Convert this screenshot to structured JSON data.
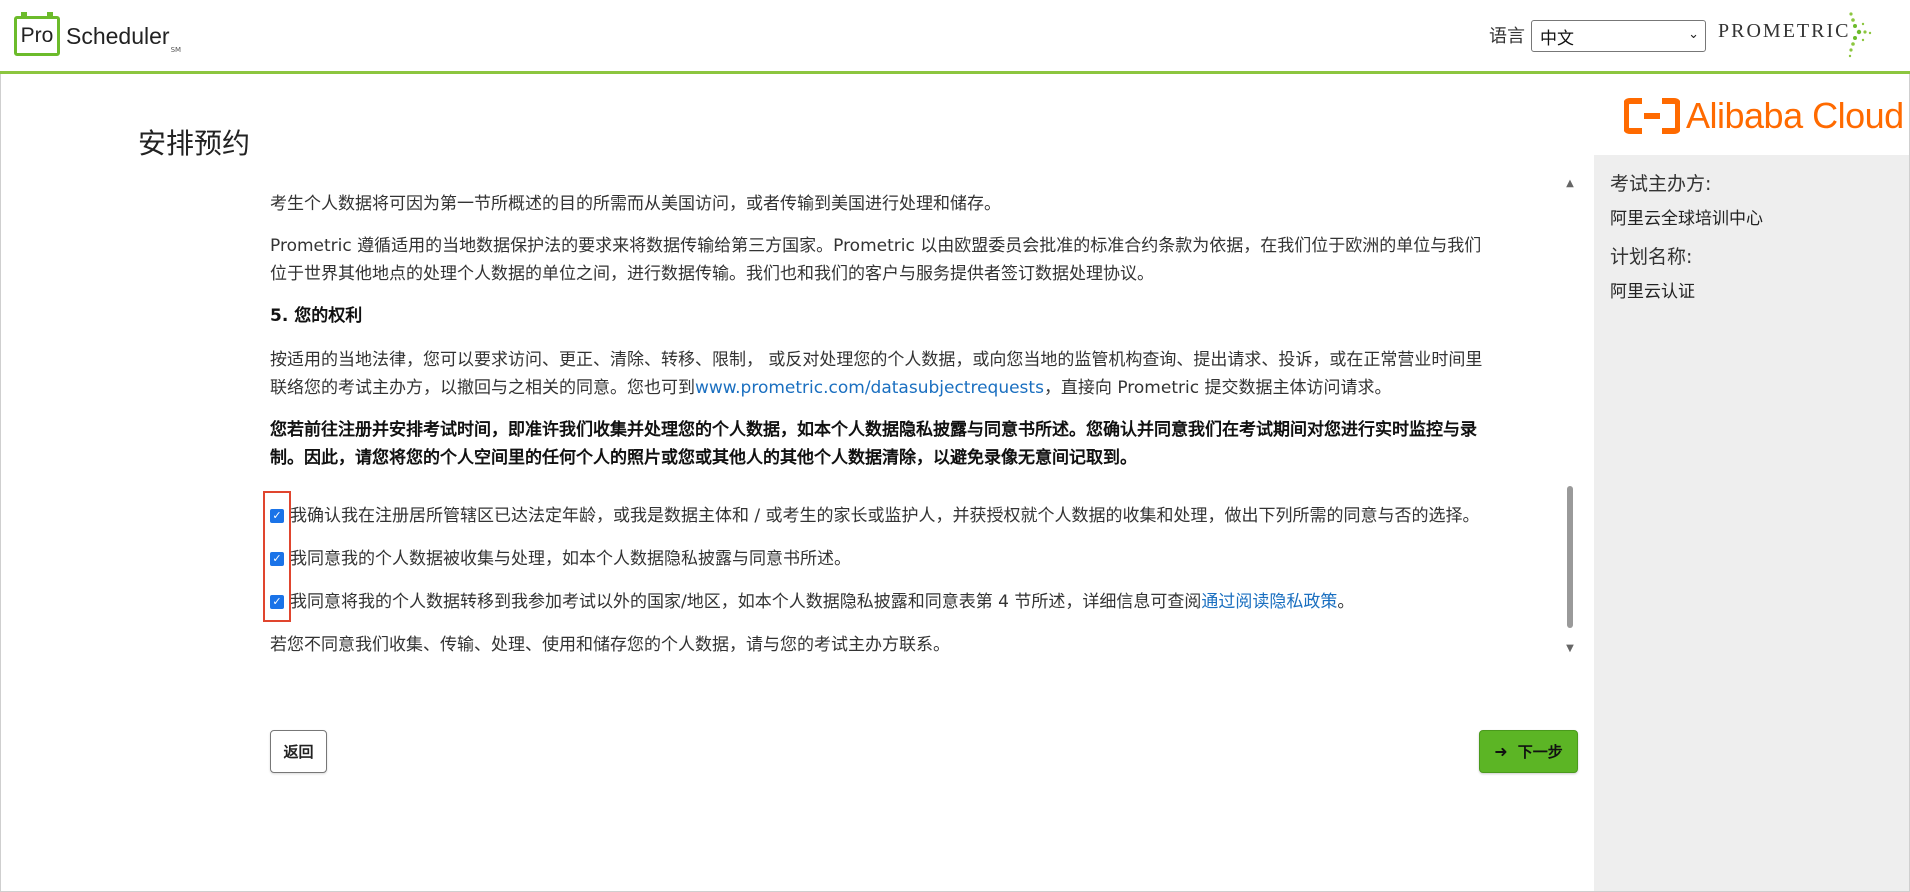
{
  "header": {
    "logo_pro": "Pro",
    "logo_scheduler": "Scheduler",
    "logo_sm": "SM",
    "language_label": "语言",
    "language_selected": "中文",
    "prometric_brand": "PROMETRIC"
  },
  "page": {
    "title": "安排预约"
  },
  "content": {
    "p1": "考生个人数据将可因为第一节所概述的目的所需而从美国访问，或者传输到美国进行处理和储存。",
    "p2_line1": "Prometric 遵循适用的当地数据保护法的要求来将数据传输给第三方国家。Prometric 以由欧盟委员会批准的标准合约条款为依据，在我们位于欧洲的单位与我们",
    "p2_line2": "位于世界其他地点的处理个人数据的单位之间，进行数据传输。我们也和我们的客户与服务提供者签订数据处理协议。",
    "section5_heading": "5. 您的权利",
    "p3_line1": "按适用的当地法律，您可以要求访问、更正、清除、转移、限制， 或反对处理您的个人数据，或向您当地的监管机构查询、提出请求、投诉，或在正常营业时间里",
    "p3_line2_pre": "联络您的考试主办方，以撤回与之相关的同意。您也可到",
    "p3_link": "www.prometric.com/datasubjectrequests",
    "p3_line2_post": "，直接向 Prometric 提交数据主体访问请求。",
    "bold_line1": "您若前往注册并安排考试时间，即准许我们收集并处理您的个人数据，如本个人数据隐私披露与同意书所述。您确认并同意我们在考试期间对您进行实时监控与录",
    "bold_line2": "制。因此，请您将您的个人空间里的任何个人的照片或您或其他人的其他个人数据清除，以避免录像无意间记取到。",
    "checkbox1": "我确认我在注册居所管辖区已达法定年龄，或我是数据主体和 / 或考生的家长或监护人，并获授权就个人数据的收集和处理，做出下列所需的同意与否的选择。",
    "checkbox2": "我同意我的个人数据被收集与处理，如本个人数据隐私披露与同意书所述。",
    "checkbox3_pre": "我同意将我的个人数据转移到我参加考试以外的国家/地区，如本个人数据隐私披露和同意表第 4 节所述，详细信息可查阅 ",
    "checkbox3_link": "通过阅读隐私政策",
    "checkbox3_post": "。",
    "footer_note": "若您不同意我们收集、传输、处理、使用和储存您的个人数据，请与您的考试主办方联系。",
    "checkbox_states": [
      true,
      true,
      true
    ]
  },
  "buttons": {
    "back": "返回",
    "next": "下一步"
  },
  "sidebar": {
    "brand": "Alibaba Cloud",
    "sponsor_label": "考试主办方:",
    "sponsor_value": "阿里云全球培训中心",
    "program_label": "计划名称:",
    "program_value": "阿里云认证"
  },
  "colors": {
    "accent_green": "#8cc63f",
    "next_button": "#5cb525",
    "alibaba_orange": "#ff6a00",
    "link_blue": "#1a6fc0",
    "highlight_red": "#e0452e",
    "sidebar_bg": "#eeeeee"
  },
  "icons": {
    "dropdown": "chevron-down-icon",
    "next_arrow": "arrow-right-icon",
    "checkbox": "check-icon"
  }
}
